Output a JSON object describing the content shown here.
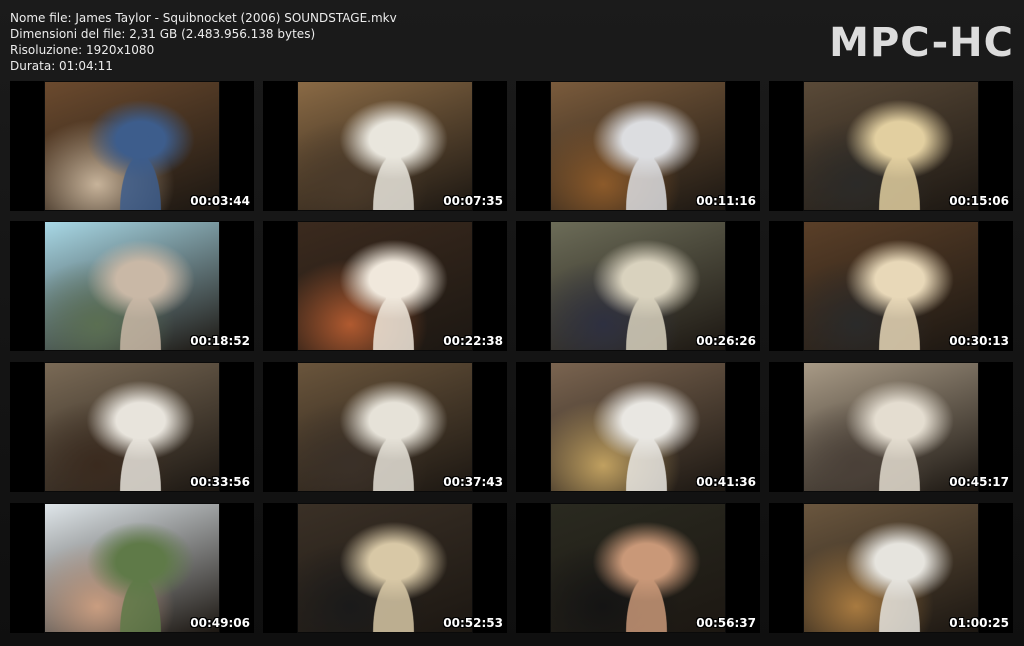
{
  "info": {
    "filename": "Nome file: James Taylor - Squibnocket (2006) SOUNDSTAGE.mkv",
    "filesize": "Dimensioni del file: 2,31 GB (2.483.956.138 bytes)",
    "resolution": "Risoluzione: 1920x1080",
    "duration": "Durata: 01:04:11"
  },
  "logo": "MPC-HC",
  "thumbnails": [
    {
      "time": "00:03:44",
      "palette": [
        "#6b4a2e",
        "#3d5d8c",
        "#c7b39a"
      ]
    },
    {
      "time": "00:07:35",
      "palette": [
        "#8a6a45",
        "#e9e6dd",
        "#4a3a2a"
      ]
    },
    {
      "time": "00:11:16",
      "palette": [
        "#7a5b3c",
        "#dcdde0",
        "#8c5a2a"
      ]
    },
    {
      "time": "00:15:06",
      "palette": [
        "#5a4a38",
        "#e2cfa0",
        "#2b2a28"
      ]
    },
    {
      "time": "00:18:52",
      "palette": [
        "#a8d8e6",
        "#c9b8a6",
        "#5b6f52"
      ]
    },
    {
      "time": "00:22:38",
      "palette": [
        "#3b2a1e",
        "#f0e8dc",
        "#b05a30"
      ]
    },
    {
      "time": "00:26:26",
      "palette": [
        "#6c6c58",
        "#d9d2be",
        "#2e3040"
      ]
    },
    {
      "time": "00:30:13",
      "palette": [
        "#5a3f28",
        "#e8d8b8",
        "#2a2a2a"
      ]
    },
    {
      "time": "00:33:56",
      "palette": [
        "#7a6a56",
        "#e8e4dc",
        "#3a2a1e"
      ]
    },
    {
      "time": "00:37:43",
      "palette": [
        "#6a553c",
        "#e6e2d8",
        "#3a3028"
      ]
    },
    {
      "time": "00:41:36",
      "palette": [
        "#7a6450",
        "#e9e7e2",
        "#c0a060"
      ]
    },
    {
      "time": "00:45:17",
      "palette": [
        "#a89a86",
        "#e4ddd0",
        "#4a4038"
      ]
    },
    {
      "time": "00:49:06",
      "palette": [
        "#dfe6ea",
        "#5f7a48",
        "#c99d80"
      ]
    },
    {
      "time": "00:52:53",
      "palette": [
        "#3a3026",
        "#d8c8a6",
        "#1a1a1a"
      ]
    },
    {
      "time": "00:56:37",
      "palette": [
        "#2a2a20",
        "#c99878",
        "#141414"
      ]
    },
    {
      "time": "01:00:25",
      "palette": [
        "#6a563e",
        "#e6e4de",
        "#a87a40"
      ]
    }
  ]
}
